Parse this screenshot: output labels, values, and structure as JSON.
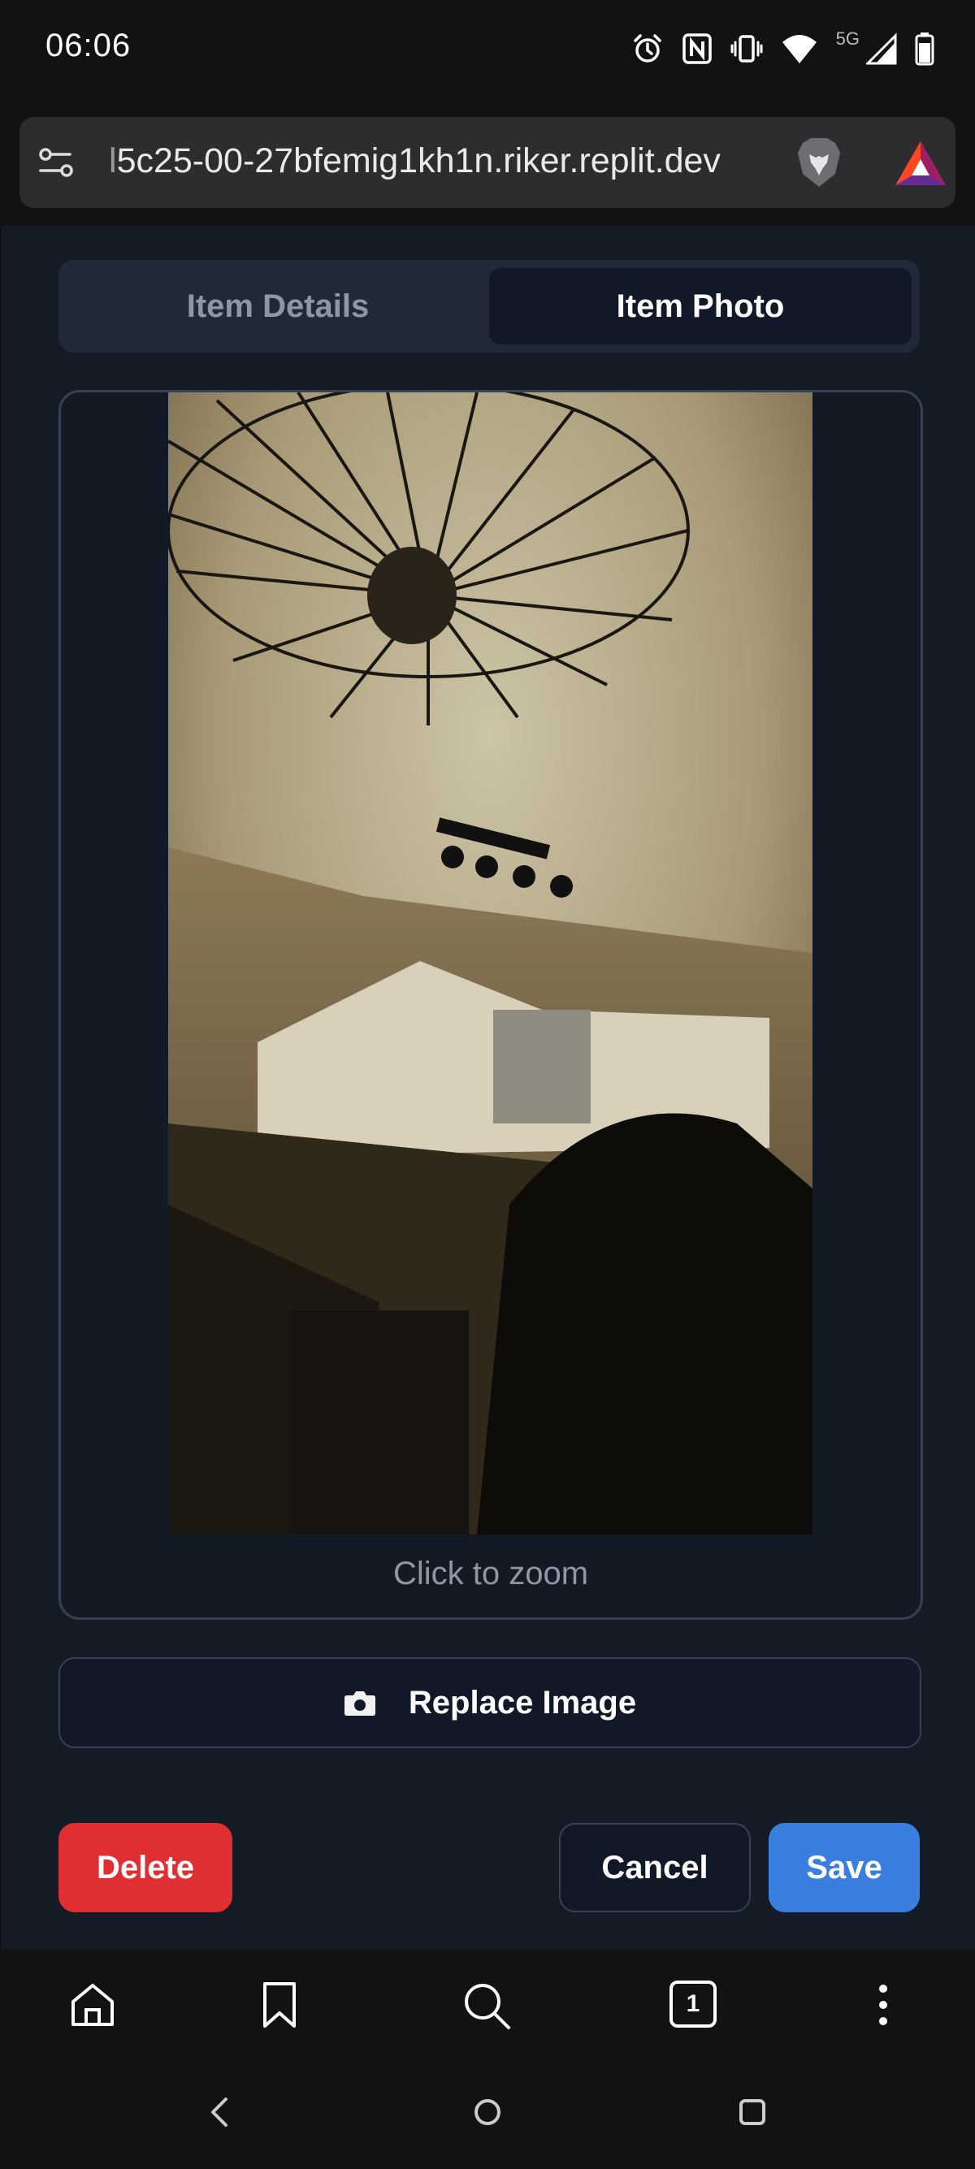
{
  "status_bar": {
    "time": "06:06",
    "network_label": "5G",
    "icons": [
      "alarm-icon",
      "nfc-icon",
      "vibrate-icon",
      "wifi-icon",
      "signal-icon",
      "battery-icon"
    ]
  },
  "browser": {
    "url_faded": "l",
    "url": "5c25-00-27bfemig1kh1n.riker.replit.dev",
    "icons": [
      "site-settings-icon",
      "brave-shields-icon",
      "bat-rewards-icon"
    ]
  },
  "tabs": {
    "details_label": "Item Details",
    "photo_label": "Item Photo",
    "active": "Item Photo"
  },
  "photo": {
    "zoom_hint": "Click to zoom"
  },
  "replace": {
    "label": "Replace Image",
    "icon": "camera-icon"
  },
  "actions": {
    "delete_label": "Delete",
    "cancel_label": "Cancel",
    "save_label": "Save"
  },
  "bottom_bar": {
    "tab_count": "1",
    "icons": [
      "home-icon",
      "bookmark-icon",
      "search-icon",
      "tabs-icon",
      "more-icon"
    ]
  },
  "nav_bar": {
    "icons": [
      "back-icon",
      "home-circle-icon",
      "recents-icon"
    ]
  },
  "colors": {
    "app_bg": "#141b27",
    "delete": "#e02f33",
    "save": "#3b7fde",
    "border": "#374151"
  }
}
